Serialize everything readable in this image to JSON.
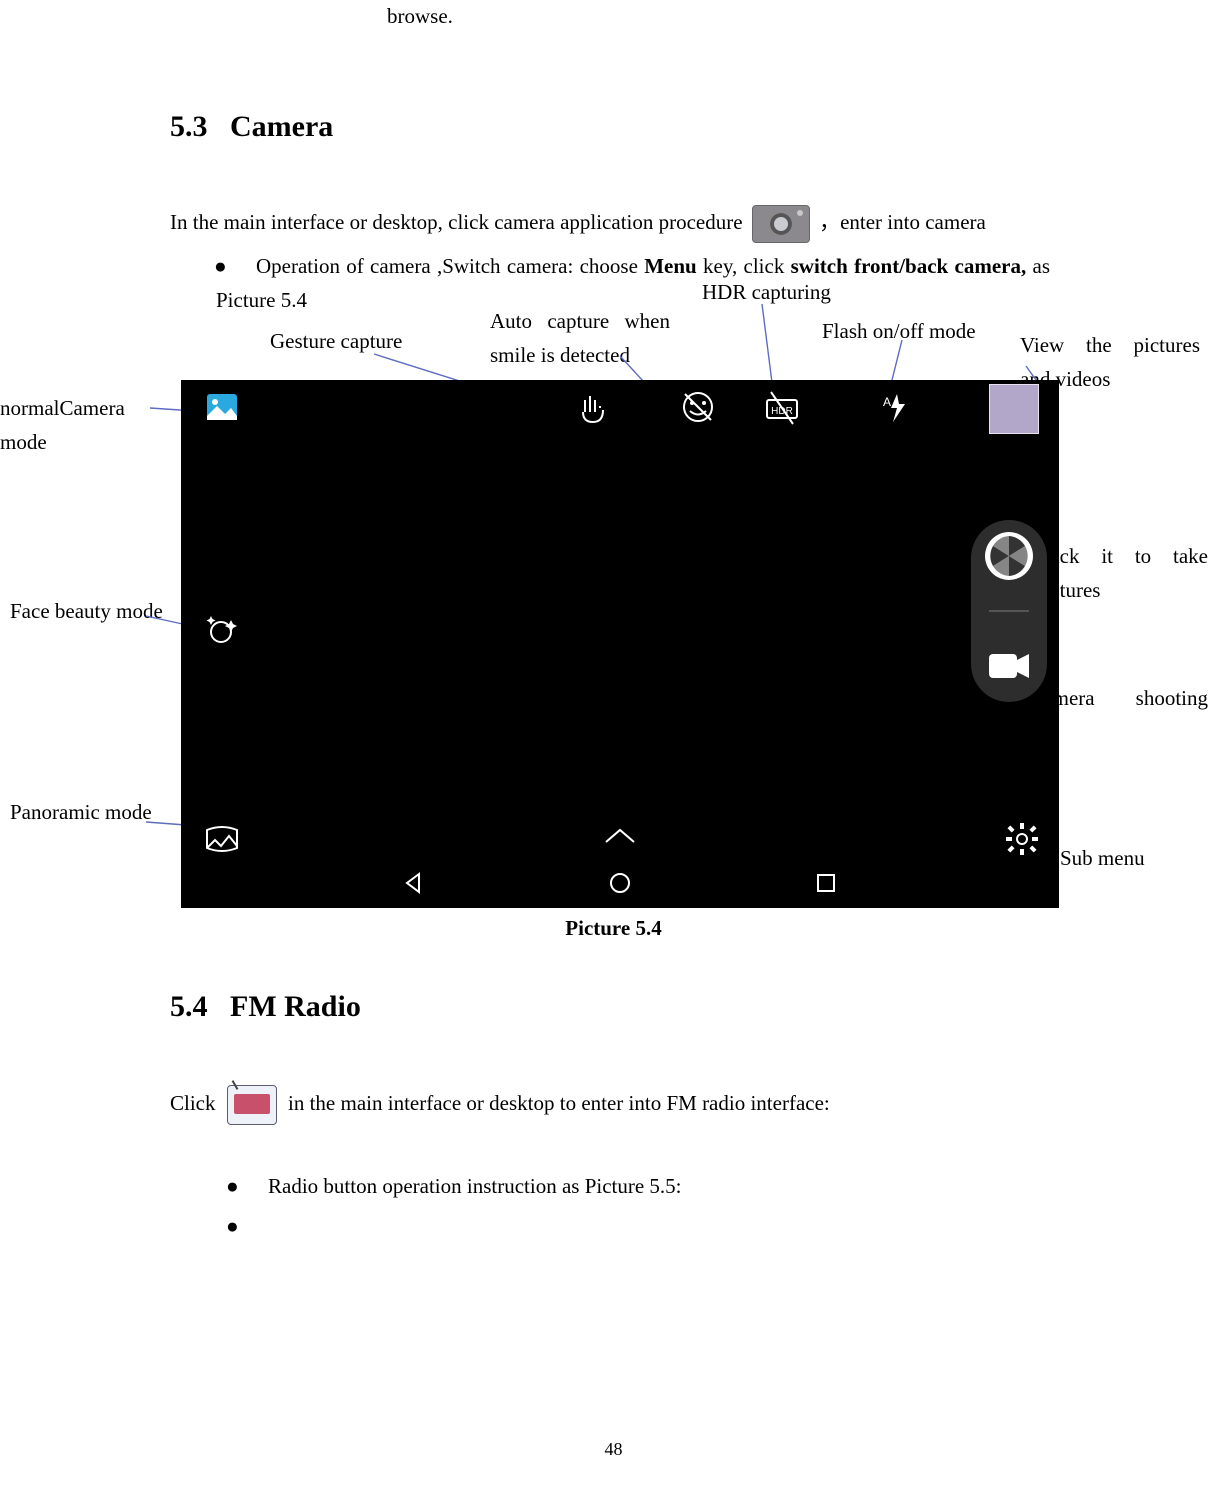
{
  "top_line": {
    "word": "browse."
  },
  "sections": {
    "camera": {
      "number": "5.3",
      "title": "Camera",
      "intro_before_icon": "In the main interface or desktop, click camera application procedure",
      "intro_after_icon": "，enter into camera",
      "bullet_part1": "Operation of camera ,Switch camera: choose",
      "bullet_menu": "Menu",
      "bullet_part2": "key, click",
      "bullet_switch": "switch front/back camera,",
      "bullet_part3": "as Picture 5.4",
      "figure_caption": "Picture 5.4"
    },
    "fmradio": {
      "number": "5.4",
      "title": "FM Radio",
      "line_before_icon": "Click",
      "line_after_icon": "in the main interface or desktop to enter into FM radio interface:",
      "bullet1": "Radio button operation instruction as Picture 5.5:"
    }
  },
  "annotations": {
    "normal_camera": "normalCamera mode",
    "face_beauty": "Face beauty mode",
    "panoramic": "Panoramic mode",
    "gesture_capture": "Gesture capture",
    "auto_capture": "Auto capture when smile is detected",
    "hdr": "HDR capturing",
    "flash": "Flash on/off mode",
    "view_pictures": "View the pictures and videos",
    "shutter": "Click it to take pictures",
    "video_mode": "camera shooting mode",
    "sub_menu": "Sub menu"
  },
  "page_number": "48"
}
